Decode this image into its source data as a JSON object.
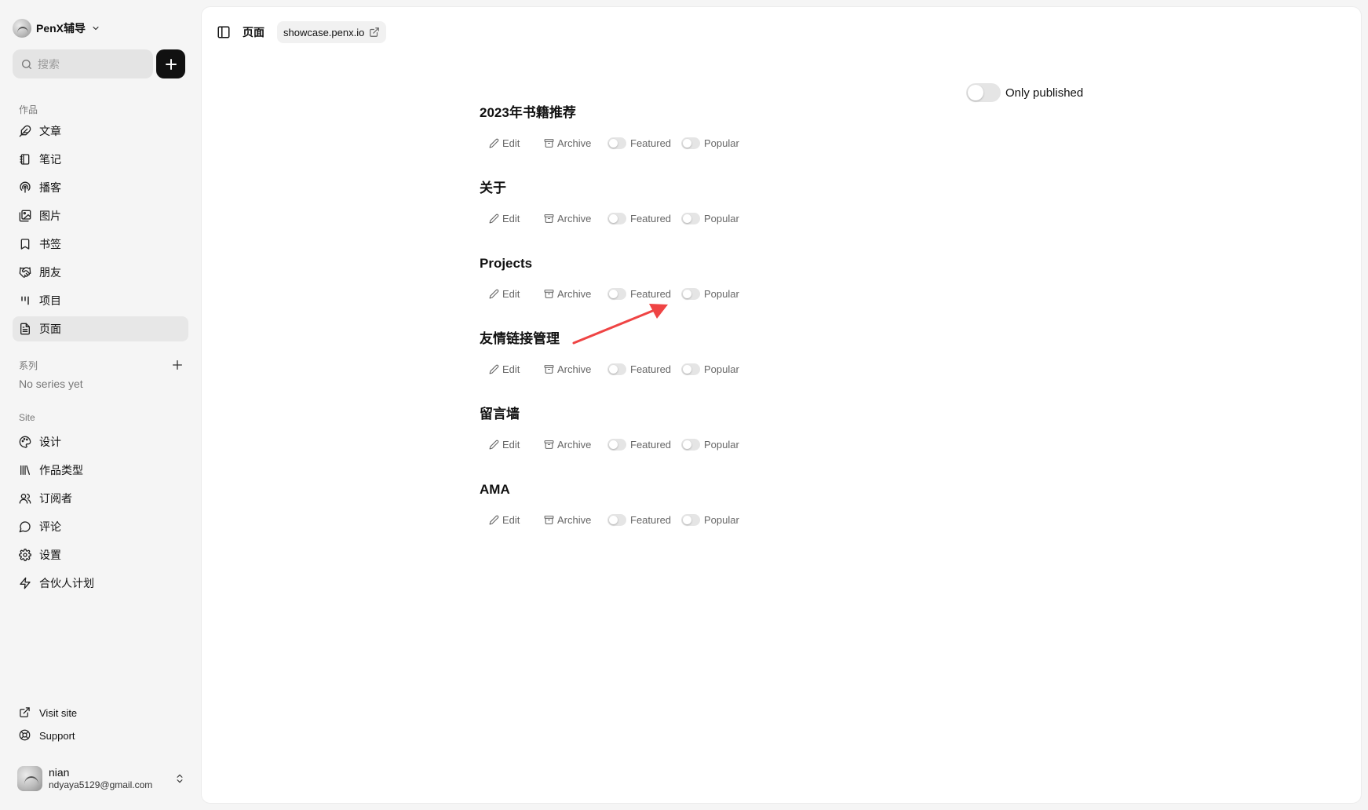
{
  "sidebar": {
    "brand": "PenX辅导",
    "search_placeholder": "搜索",
    "works_label": "作品",
    "works": [
      {
        "label": "文章",
        "icon": "feather-icon"
      },
      {
        "label": "笔记",
        "icon": "notebook-icon"
      },
      {
        "label": "播客",
        "icon": "podcast-icon"
      },
      {
        "label": "图片",
        "icon": "image-icon"
      },
      {
        "label": "书签",
        "icon": "bookmark-icon"
      },
      {
        "label": "朋友",
        "icon": "handshake-icon"
      },
      {
        "label": "项目",
        "icon": "projects-icon"
      },
      {
        "label": "页面",
        "icon": "file-text-icon",
        "active": true
      }
    ],
    "series_label": "系列",
    "series_empty": "No series yet",
    "site_label": "Site",
    "site": [
      {
        "label": "设计",
        "icon": "palette-icon"
      },
      {
        "label": "作品类型",
        "icon": "library-icon"
      },
      {
        "label": "订阅者",
        "icon": "users-icon"
      },
      {
        "label": "评论",
        "icon": "message-circle-icon"
      },
      {
        "label": "设置",
        "icon": "gear-icon"
      },
      {
        "label": "合伙人计划",
        "icon": "zap-icon"
      }
    ],
    "visit_site": "Visit site",
    "support": "Support",
    "user": {
      "name": "nian",
      "email": "ndyaya5129@gmail.com"
    }
  },
  "header": {
    "title": "页面",
    "site_url": "showcase.penx.io"
  },
  "filter": {
    "only_published": "Only published",
    "only_published_on": false
  },
  "actions": {
    "edit": "Edit",
    "archive": "Archive",
    "featured": "Featured",
    "popular": "Popular"
  },
  "pages": [
    {
      "title": "2023年书籍推荐",
      "featured": false,
      "popular": false
    },
    {
      "title": "关于",
      "featured": false,
      "popular": false
    },
    {
      "title": "Projects",
      "featured": false,
      "popular": false
    },
    {
      "title": "友情链接管理",
      "featured": false,
      "popular": false
    },
    {
      "title": "留言墙",
      "featured": false,
      "popular": false
    },
    {
      "title": "AMA",
      "featured": false,
      "popular": false
    }
  ],
  "colors": {
    "accent": "#111111",
    "annotation_arrow": "#ef4444",
    "active_nav_bg": "#e7e7e7"
  }
}
